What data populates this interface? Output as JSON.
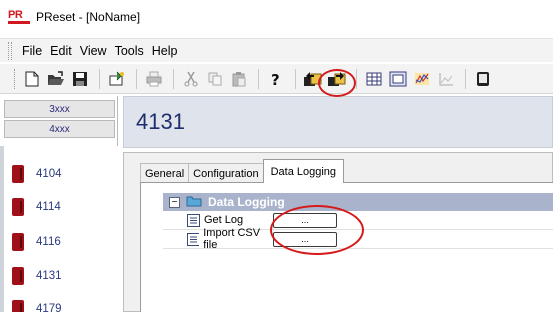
{
  "window": {
    "title": "PReset - [NoName]",
    "logo_text": "PR"
  },
  "menu": {
    "items": [
      "File",
      "Edit",
      "View",
      "Tools",
      "Help"
    ]
  },
  "toolbar": {
    "buttons": [
      {
        "icon": "new-file-icon"
      },
      {
        "icon": "open-folder-icon"
      },
      {
        "icon": "save-icon"
      },
      {
        "icon": "wizard-icon"
      },
      {
        "icon": "print-icon"
      },
      {
        "icon": "cut-icon"
      },
      {
        "icon": "copy-icon"
      },
      {
        "icon": "paste-icon"
      },
      {
        "icon": "help-icon"
      },
      {
        "icon": "read-from-device-icon"
      },
      {
        "icon": "write-to-device-icon"
      },
      {
        "icon": "table-view-icon"
      },
      {
        "icon": "monitor-icon"
      },
      {
        "icon": "trend-icon"
      },
      {
        "icon": "chart-icon"
      },
      {
        "icon": "device-icon"
      }
    ]
  },
  "left_panel": {
    "version_tabs": [
      "3xxx",
      "4xxx"
    ],
    "devices": [
      "4104",
      "4114",
      "4116",
      "4131",
      "4179"
    ]
  },
  "main": {
    "title": "4131",
    "tabs": [
      "General",
      "Configuration",
      "Data Logging"
    ],
    "active_tab": "Data Logging",
    "section": {
      "title": "Data Logging",
      "collapse_symbol": "−",
      "rows": [
        {
          "label": "Get Log",
          "button": "..."
        },
        {
          "label": "Import CSV file",
          "button": "..."
        }
      ]
    }
  },
  "colors": {
    "accent_red": "#d41a1a",
    "header_bg": "#dfe3ec",
    "tree_header_bg": "#a9b4cc",
    "device_red": "#a01018"
  }
}
